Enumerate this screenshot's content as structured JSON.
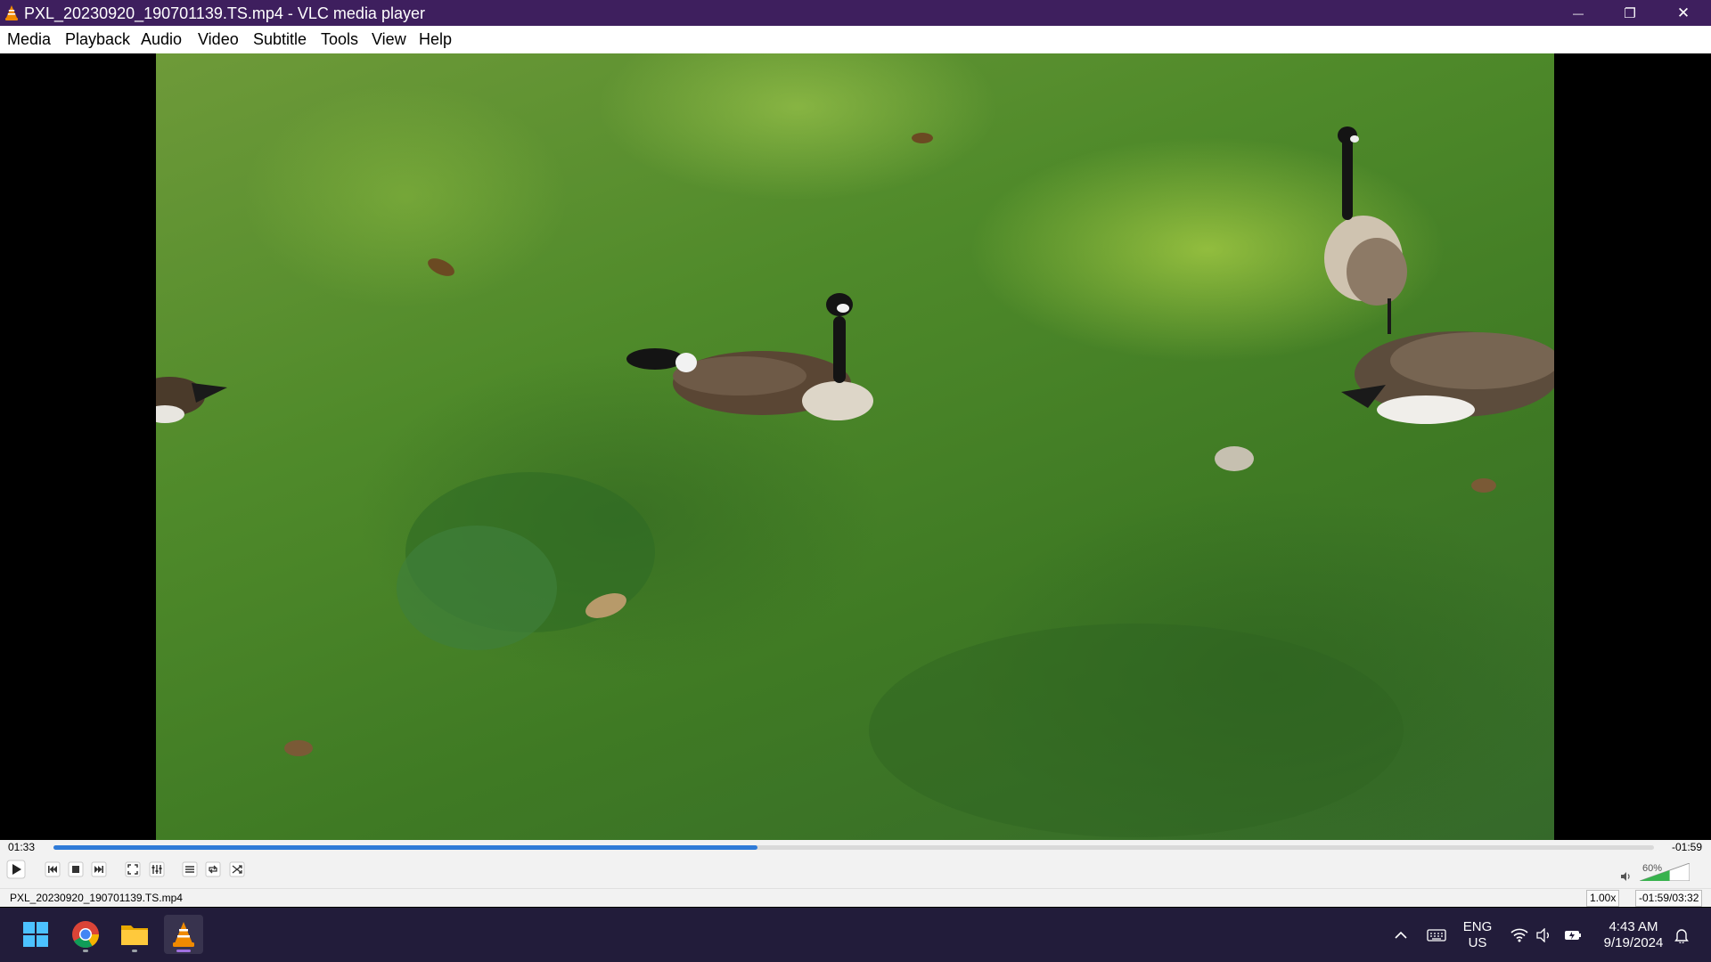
{
  "window": {
    "title": "PXL_20230920_190701139.TS.mp4 - VLC media player",
    "minimize_glyph": "—",
    "restore_glyph": "❐",
    "close_glyph": "✕"
  },
  "menu": [
    "Media",
    "Playback",
    "Audio",
    "Video",
    "Subtitle",
    "Tools",
    "View",
    "Help"
  ],
  "player": {
    "elapsed": "01:33",
    "remaining": "-01:59",
    "progress_fraction": 0.44,
    "volume_label": "60%",
    "volume_fraction": 0.6
  },
  "status": {
    "filename": "PXL_20230920_190701139.TS.mp4",
    "speed": "1.00x",
    "time_summary": "-01:59/03:32"
  },
  "taskbar": {
    "apps": [
      "windows-start",
      "chrome",
      "file-explorer",
      "vlc"
    ],
    "language_top": "ENG",
    "language_bottom": "US",
    "clock_time": "4:43 AM",
    "clock_date": "9/19/2024"
  },
  "colors": {
    "titlebar": "#3e1f5e",
    "taskbar": "#221c3a",
    "seek_fill": "#2f7bd8",
    "vlc_orange": "#f08a00"
  }
}
